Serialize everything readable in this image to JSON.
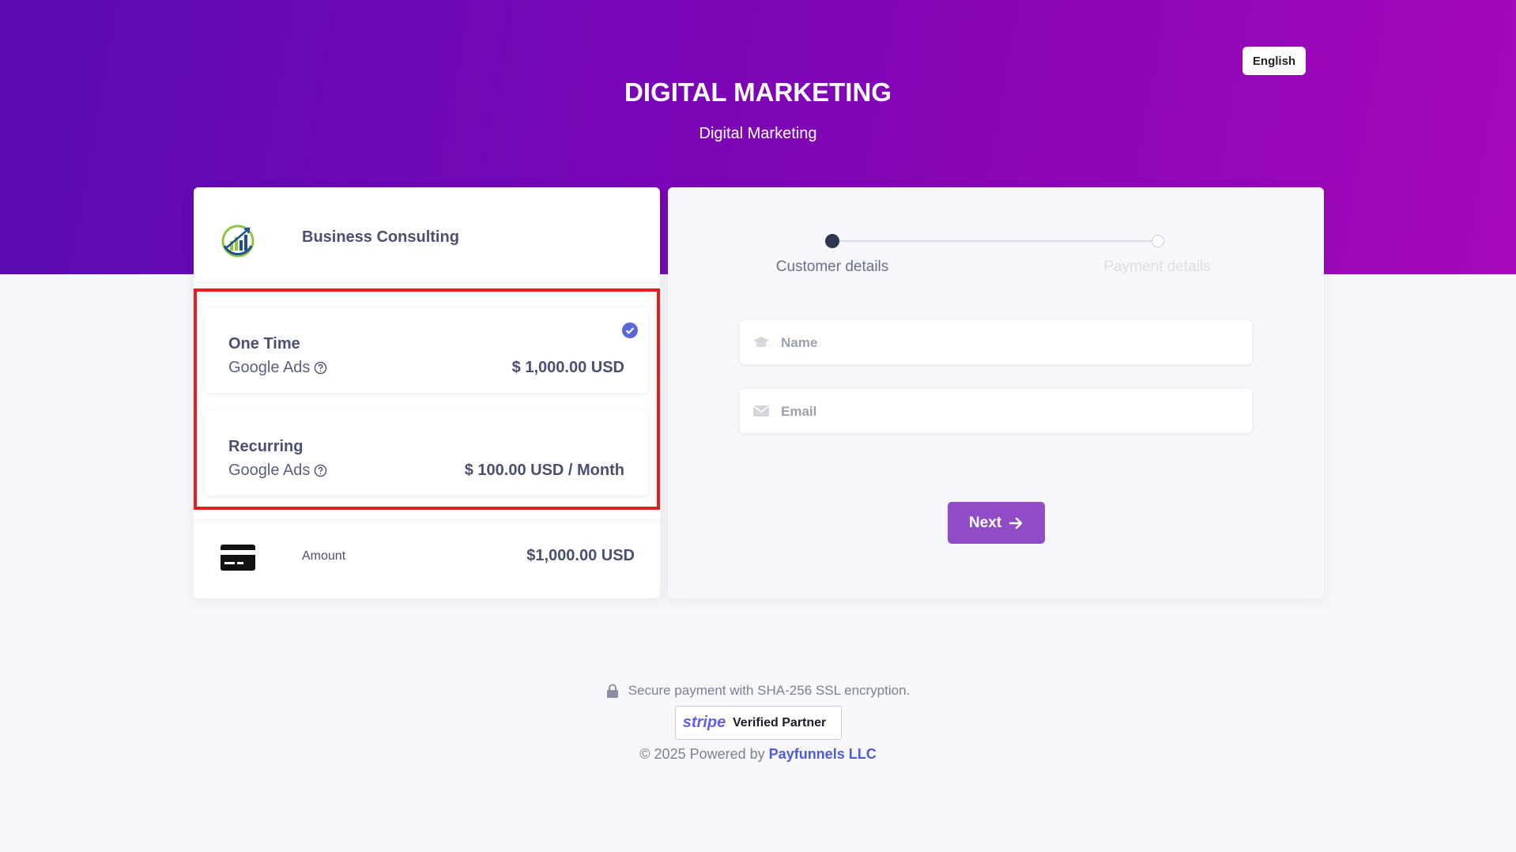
{
  "header": {
    "language": "English",
    "title": "DIGITAL MARKETING",
    "subtitle": "Digital Marketing"
  },
  "business": {
    "name": "Business Consulting",
    "logo_icon": "growth-chart-icon"
  },
  "plans": [
    {
      "title": "One Time",
      "description": "Google Ads",
      "price": "$ 1,000.00 USD",
      "selected": true
    },
    {
      "title": "Recurring",
      "description": "Google Ads",
      "price": "$ 100.00 USD / Month",
      "selected": false
    }
  ],
  "amount": {
    "label": "Amount",
    "value": "$1,000.00 USD"
  },
  "stepper": {
    "steps": [
      {
        "label": "Customer details",
        "active": true
      },
      {
        "label": "Payment details",
        "active": false
      }
    ]
  },
  "form": {
    "name_placeholder": "Name",
    "email_placeholder": "Email",
    "next_label": "Next"
  },
  "footer": {
    "secure_text": "Secure payment with SHA-256 SSL encryption.",
    "stripe_logo": "stripe",
    "stripe_badge": "Verified Partner",
    "copyright_prefix": "© 2025 Powered by",
    "company": "Payfunnels LLC"
  },
  "colors": {
    "accent": "#8f4cc6",
    "highlight": "#e01f1f",
    "check": "#5b67d8",
    "link": "#4f5ad9"
  }
}
